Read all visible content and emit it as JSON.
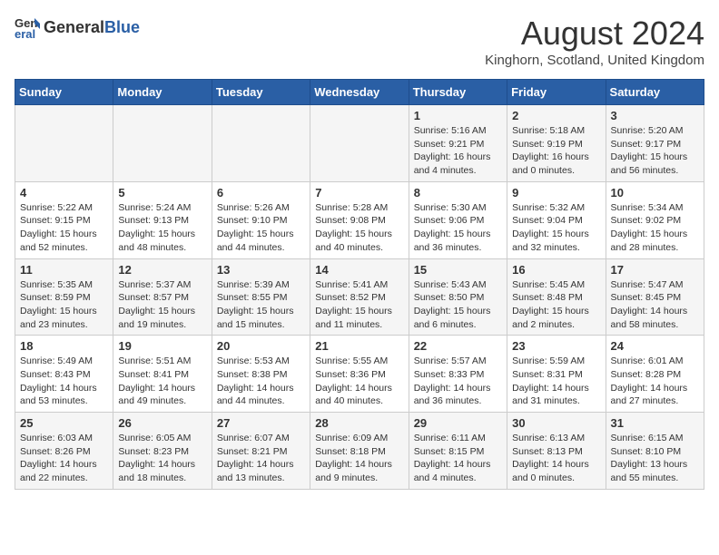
{
  "header": {
    "logo_general": "General",
    "logo_blue": "Blue",
    "month_year": "August 2024",
    "location": "Kinghorn, Scotland, United Kingdom"
  },
  "weekdays": [
    "Sunday",
    "Monday",
    "Tuesday",
    "Wednesday",
    "Thursday",
    "Friday",
    "Saturday"
  ],
  "weeks": [
    [
      {
        "day": "",
        "info": ""
      },
      {
        "day": "",
        "info": ""
      },
      {
        "day": "",
        "info": ""
      },
      {
        "day": "",
        "info": ""
      },
      {
        "day": "1",
        "info": "Sunrise: 5:16 AM\nSunset: 9:21 PM\nDaylight: 16 hours\nand 4 minutes."
      },
      {
        "day": "2",
        "info": "Sunrise: 5:18 AM\nSunset: 9:19 PM\nDaylight: 16 hours\nand 0 minutes."
      },
      {
        "day": "3",
        "info": "Sunrise: 5:20 AM\nSunset: 9:17 PM\nDaylight: 15 hours\nand 56 minutes."
      }
    ],
    [
      {
        "day": "4",
        "info": "Sunrise: 5:22 AM\nSunset: 9:15 PM\nDaylight: 15 hours\nand 52 minutes."
      },
      {
        "day": "5",
        "info": "Sunrise: 5:24 AM\nSunset: 9:13 PM\nDaylight: 15 hours\nand 48 minutes."
      },
      {
        "day": "6",
        "info": "Sunrise: 5:26 AM\nSunset: 9:10 PM\nDaylight: 15 hours\nand 44 minutes."
      },
      {
        "day": "7",
        "info": "Sunrise: 5:28 AM\nSunset: 9:08 PM\nDaylight: 15 hours\nand 40 minutes."
      },
      {
        "day": "8",
        "info": "Sunrise: 5:30 AM\nSunset: 9:06 PM\nDaylight: 15 hours\nand 36 minutes."
      },
      {
        "day": "9",
        "info": "Sunrise: 5:32 AM\nSunset: 9:04 PM\nDaylight: 15 hours\nand 32 minutes."
      },
      {
        "day": "10",
        "info": "Sunrise: 5:34 AM\nSunset: 9:02 PM\nDaylight: 15 hours\nand 28 minutes."
      }
    ],
    [
      {
        "day": "11",
        "info": "Sunrise: 5:35 AM\nSunset: 8:59 PM\nDaylight: 15 hours\nand 23 minutes."
      },
      {
        "day": "12",
        "info": "Sunrise: 5:37 AM\nSunset: 8:57 PM\nDaylight: 15 hours\nand 19 minutes."
      },
      {
        "day": "13",
        "info": "Sunrise: 5:39 AM\nSunset: 8:55 PM\nDaylight: 15 hours\nand 15 minutes."
      },
      {
        "day": "14",
        "info": "Sunrise: 5:41 AM\nSunset: 8:52 PM\nDaylight: 15 hours\nand 11 minutes."
      },
      {
        "day": "15",
        "info": "Sunrise: 5:43 AM\nSunset: 8:50 PM\nDaylight: 15 hours\nand 6 minutes."
      },
      {
        "day": "16",
        "info": "Sunrise: 5:45 AM\nSunset: 8:48 PM\nDaylight: 15 hours\nand 2 minutes."
      },
      {
        "day": "17",
        "info": "Sunrise: 5:47 AM\nSunset: 8:45 PM\nDaylight: 14 hours\nand 58 minutes."
      }
    ],
    [
      {
        "day": "18",
        "info": "Sunrise: 5:49 AM\nSunset: 8:43 PM\nDaylight: 14 hours\nand 53 minutes."
      },
      {
        "day": "19",
        "info": "Sunrise: 5:51 AM\nSunset: 8:41 PM\nDaylight: 14 hours\nand 49 minutes."
      },
      {
        "day": "20",
        "info": "Sunrise: 5:53 AM\nSunset: 8:38 PM\nDaylight: 14 hours\nand 44 minutes."
      },
      {
        "day": "21",
        "info": "Sunrise: 5:55 AM\nSunset: 8:36 PM\nDaylight: 14 hours\nand 40 minutes."
      },
      {
        "day": "22",
        "info": "Sunrise: 5:57 AM\nSunset: 8:33 PM\nDaylight: 14 hours\nand 36 minutes."
      },
      {
        "day": "23",
        "info": "Sunrise: 5:59 AM\nSunset: 8:31 PM\nDaylight: 14 hours\nand 31 minutes."
      },
      {
        "day": "24",
        "info": "Sunrise: 6:01 AM\nSunset: 8:28 PM\nDaylight: 14 hours\nand 27 minutes."
      }
    ],
    [
      {
        "day": "25",
        "info": "Sunrise: 6:03 AM\nSunset: 8:26 PM\nDaylight: 14 hours\nand 22 minutes."
      },
      {
        "day": "26",
        "info": "Sunrise: 6:05 AM\nSunset: 8:23 PM\nDaylight: 14 hours\nand 18 minutes."
      },
      {
        "day": "27",
        "info": "Sunrise: 6:07 AM\nSunset: 8:21 PM\nDaylight: 14 hours\nand 13 minutes."
      },
      {
        "day": "28",
        "info": "Sunrise: 6:09 AM\nSunset: 8:18 PM\nDaylight: 14 hours\nand 9 minutes."
      },
      {
        "day": "29",
        "info": "Sunrise: 6:11 AM\nSunset: 8:15 PM\nDaylight: 14 hours\nand 4 minutes."
      },
      {
        "day": "30",
        "info": "Sunrise: 6:13 AM\nSunset: 8:13 PM\nDaylight: 14 hours\nand 0 minutes."
      },
      {
        "day": "31",
        "info": "Sunrise: 6:15 AM\nSunset: 8:10 PM\nDaylight: 13 hours\nand 55 minutes."
      }
    ]
  ]
}
